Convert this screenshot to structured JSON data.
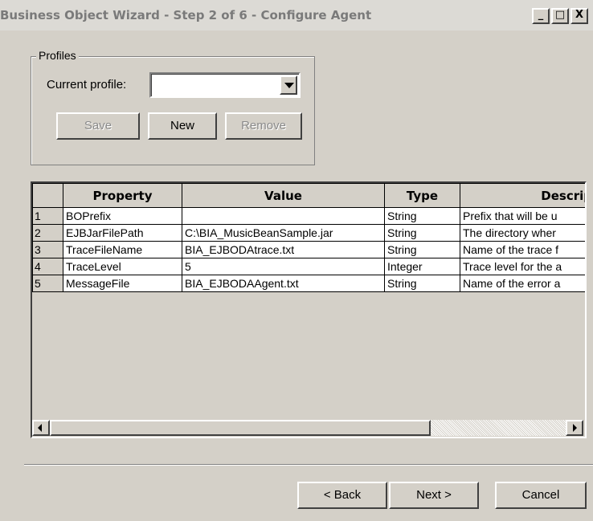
{
  "window": {
    "title": "Business Object Wizard - Step 2 of 6 - Configure Agent",
    "controls": [
      "_",
      "□",
      "X"
    ]
  },
  "profiles": {
    "group_label": "Profiles",
    "current_profile_label": "Current profile:",
    "current_profile_value": "",
    "buttons": {
      "save": "Save",
      "new": "New",
      "remove": "Remove"
    }
  },
  "table": {
    "columns": [
      "Property",
      "Value",
      "Type",
      "Descrip"
    ],
    "rows": [
      {
        "num": "1",
        "property": "BOPrefix",
        "value": "",
        "type": "String",
        "description": "Prefix that will be u"
      },
      {
        "num": "2",
        "property": "EJBJarFilePath",
        "value": "C:\\BIA_MusicBeanSample.jar",
        "type": "String",
        "description": "The directory wher"
      },
      {
        "num": "3",
        "property": "TraceFileName",
        "value": "BIA_EJBODAtrace.txt",
        "type": "String",
        "description": "Name of the trace f"
      },
      {
        "num": "4",
        "property": "TraceLevel",
        "value": "5",
        "type": "Integer",
        "description": "Trace level for the a"
      },
      {
        "num": "5",
        "property": "MessageFile",
        "value": "BIA_EJBODAAgent.txt",
        "type": "String",
        "description": "Name of the error a"
      }
    ]
  },
  "footer": {
    "back": "< Back",
    "next": "Next >",
    "cancel": "Cancel"
  }
}
